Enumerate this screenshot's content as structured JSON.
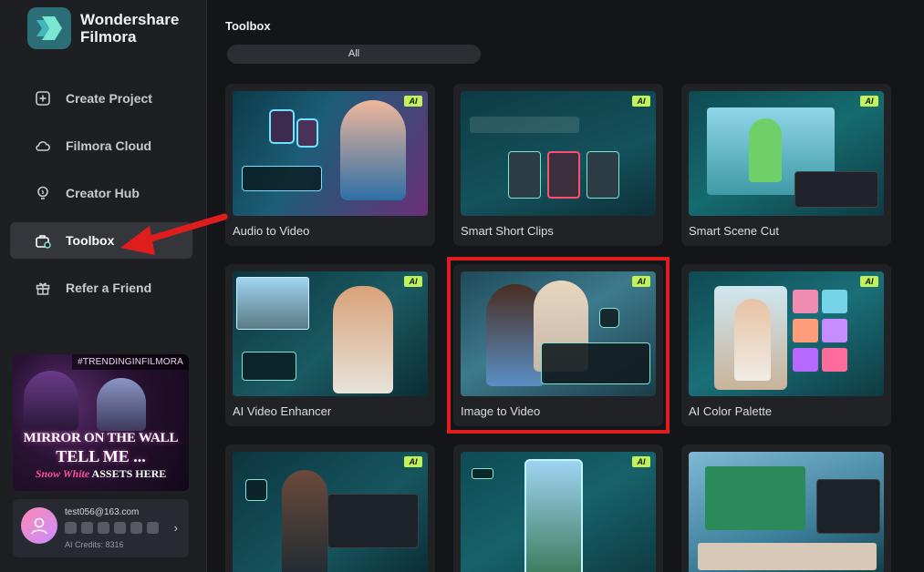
{
  "app": {
    "brand_line1": "Wondershare",
    "brand_line2": "Filmora"
  },
  "sidebar": {
    "items": [
      {
        "label": "Create Project",
        "icon": "plus-square-icon"
      },
      {
        "label": "Filmora Cloud",
        "icon": "cloud-icon"
      },
      {
        "label": "Creator Hub",
        "icon": "bulb-icon"
      },
      {
        "label": "Toolbox",
        "icon": "toolbox-icon",
        "active": true
      },
      {
        "label": "Refer a Friend",
        "icon": "gift-icon"
      }
    ],
    "promo": {
      "tag": "#TRENDINGINFILMORA",
      "line1": "MIRROR ON THE WALL",
      "line2": "TELL ME ...",
      "line3a": "Snow White",
      "line3b": " ASSETS HERE"
    },
    "user": {
      "email": "test056@163.com",
      "credits": "AI Credits: 8316"
    }
  },
  "main": {
    "title": "Toolbox",
    "filter_all": "All",
    "ai_badge": "AI",
    "cards": [
      {
        "label": "Audio to Video"
      },
      {
        "label": "Smart Short Clips"
      },
      {
        "label": "Smart Scene Cut"
      },
      {
        "label": "AI Video Enhancer"
      },
      {
        "label": "Image to Video"
      },
      {
        "label": "AI Color Palette"
      },
      {
        "label": ""
      },
      {
        "label": ""
      },
      {
        "label": ""
      }
    ]
  },
  "colors": {
    "accent_ai": "#c2f25a",
    "highlight": "#e01d1d",
    "active_nav": "#34363c"
  }
}
